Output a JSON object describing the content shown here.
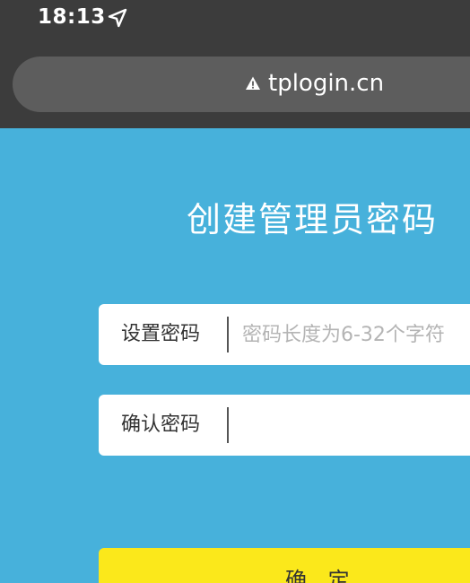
{
  "status_bar": {
    "time": "18:13",
    "location_icon": "location-arrow-icon"
  },
  "browser": {
    "url": "tplogin.cn",
    "warning_icon": "warning-triangle-icon"
  },
  "page": {
    "title": "创建管理员密码",
    "password_field": {
      "label": "设置密码",
      "placeholder": "密码长度为6-32个字符",
      "value": ""
    },
    "confirm_field": {
      "label": "确认密码",
      "placeholder": "",
      "value": ""
    },
    "confirm_button_label": "确 定"
  },
  "colors": {
    "background": "#47b1db",
    "chrome": "#3c3c3c",
    "url_bar": "#5d5d5d",
    "button": "#fbe81b"
  }
}
